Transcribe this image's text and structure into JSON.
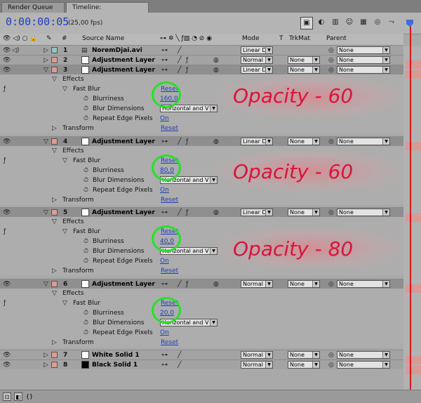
{
  "tabs": [
    {
      "label": "Render Queue"
    },
    {
      "label": "Timeline: NoremDjai",
      "close": "x"
    }
  ],
  "timecode": "0:00:00:05",
  "fps": "(25,00 fps)",
  "headers": {
    "hash": "#",
    "source_name": "Source Name",
    "mode": "Mode",
    "t": "T",
    "trkmat": "TrkMat",
    "parent": "Parent"
  },
  "layers": [
    {
      "num": "1",
      "name": "NoremDjai.avi",
      "label_color": "#8ec7c7",
      "src_color": "#dddddd",
      "mode": "Linear D",
      "trkmat": "",
      "parent": "None"
    },
    {
      "num": "2",
      "name": "Adjustment Layer",
      "label_color": "#e39a8f",
      "src_color": "#ffffff",
      "mode": "Normal",
      "trkmat": "None",
      "parent": "None"
    },
    {
      "num": "3",
      "name": "Adjustment Layer",
      "label_color": "#e39a8f",
      "src_color": "#ffffff",
      "mode": "Linear D",
      "trkmat": "None",
      "parent": "None",
      "effects_label": "Effects",
      "effect_name": "Fast Blur",
      "reset": "Reset",
      "blurriness_label": "Blurriness",
      "blurriness": "160,0",
      "dims_label": "Blur Dimensions",
      "dims": "Horizontal and V",
      "repeat_label": "Repeat Edge Pixels",
      "repeat": "On",
      "transform_label": "Transform",
      "transform_reset": "Reset"
    },
    {
      "num": "4",
      "name": "Adjustment Layer",
      "label_color": "#e39a8f",
      "src_color": "#ffffff",
      "mode": "Linear D",
      "trkmat": "None",
      "parent": "None",
      "effects_label": "Effects",
      "effect_name": "Fast Blur",
      "reset": "Reset",
      "blurriness_label": "Blurriness",
      "blurriness": "80,0",
      "dims_label": "Blur Dimensions",
      "dims": "Horizontal and V",
      "repeat_label": "Repeat Edge Pixels",
      "repeat": "On",
      "transform_label": "Transform",
      "transform_reset": "Reset"
    },
    {
      "num": "5",
      "name": "Adjustment Layer",
      "label_color": "#e39a8f",
      "src_color": "#ffffff",
      "mode": "Linear D",
      "trkmat": "None",
      "parent": "None",
      "effects_label": "Effects",
      "effect_name": "Fast Blur",
      "reset": "Reset",
      "blurriness_label": "Blurriness",
      "blurriness": "40,0",
      "dims_label": "Blur Dimensions",
      "dims": "Horizontal and V",
      "repeat_label": "Repeat Edge Pixels",
      "repeat": "On",
      "transform_label": "Transform",
      "transform_reset": "Reset"
    },
    {
      "num": "6",
      "name": "Adjustment Layer",
      "label_color": "#e39a8f",
      "src_color": "#ffffff",
      "mode": "Normal",
      "trkmat": "None",
      "parent": "None",
      "effects_label": "Effects",
      "effect_name": "Fast Blur",
      "reset": "Reset",
      "blurriness_label": "Blurriness",
      "blurriness": "20,0",
      "dims_label": "Blur Dimensions",
      "dims": "Horizontal and V",
      "repeat_label": "Repeat Edge Pixels",
      "repeat": "On",
      "transform_label": "Transform",
      "transform_reset": "Reset"
    },
    {
      "num": "7",
      "name": "White Solid 1",
      "label_color": "#e39a8f",
      "src_color": "#ffffff",
      "mode": "Normal",
      "trkmat": "None",
      "parent": "None"
    },
    {
      "num": "8",
      "name": "Black Solid 1",
      "label_color": "#e39a8f",
      "src_color": "#000000",
      "mode": "Normal",
      "trkmat": "None",
      "parent": "None"
    }
  ],
  "annotations": [
    {
      "text": "Opacity - 60"
    },
    {
      "text": "Opacity - 60"
    },
    {
      "text": "Opacity - 80"
    }
  ],
  "colors": {
    "timecode": "#1c3fc4",
    "annotation": "#d9143c",
    "highlight_ring": "#28e028",
    "current_time_indicator": "#d81818"
  }
}
